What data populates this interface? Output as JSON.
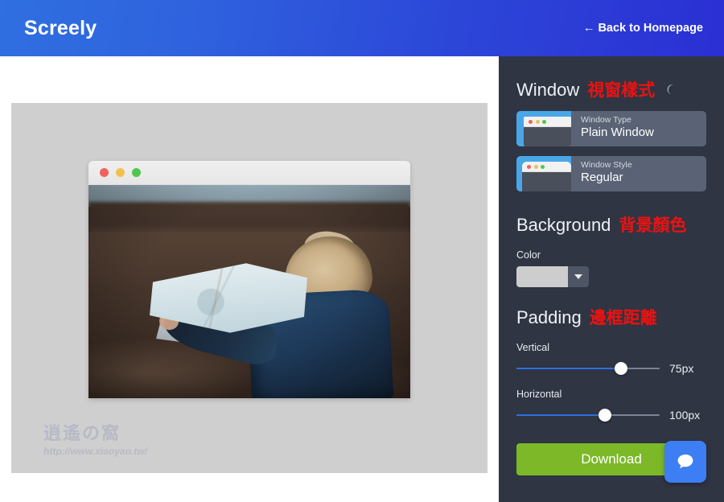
{
  "header": {
    "brand": "Screely",
    "back_link": "← Back to Homepage",
    "gradient_from": "#2f6fe0",
    "gradient_to": "#2b2fd4"
  },
  "canvas": {
    "background_color": "#cfcfcf",
    "window": {
      "titlebar_color": "#ececec",
      "dots": [
        "#f2615c",
        "#f5bf4f",
        "#4fc74f"
      ],
      "photo_description": "blond child in blue jacket holding an open map in a brown field"
    },
    "watermark": {
      "cn": "逍遙の窩",
      "url": "http://www.xiaoyao.tw/"
    }
  },
  "sidebar": {
    "background_color": "#2f3542",
    "window_section": {
      "title": "Window",
      "annotation_cn": "視窗樣式",
      "dark_mode_icon": "moon-icon",
      "options": [
        {
          "label": "Window Type",
          "value": "Plain Window",
          "thumb_color": "#49a7e8"
        },
        {
          "label": "Window Style",
          "value": "Regular",
          "thumb_color": "#49a7e8"
        }
      ]
    },
    "background_section": {
      "title": "Background",
      "annotation_cn": "背景顏色",
      "color_label": "Color",
      "color_value": "#cdcdcd"
    },
    "padding_section": {
      "title": "Padding",
      "annotation_cn": "邊框距離",
      "sliders": [
        {
          "label": "Vertical",
          "value": "75px",
          "percent": 73
        },
        {
          "label": "Horizontal",
          "value": "100px",
          "percent": 62
        }
      ]
    },
    "download_label": "Download",
    "download_color": "#7cb828",
    "chat_icon": "chat-bubble-icon",
    "chat_color": "#3d7ef5"
  }
}
